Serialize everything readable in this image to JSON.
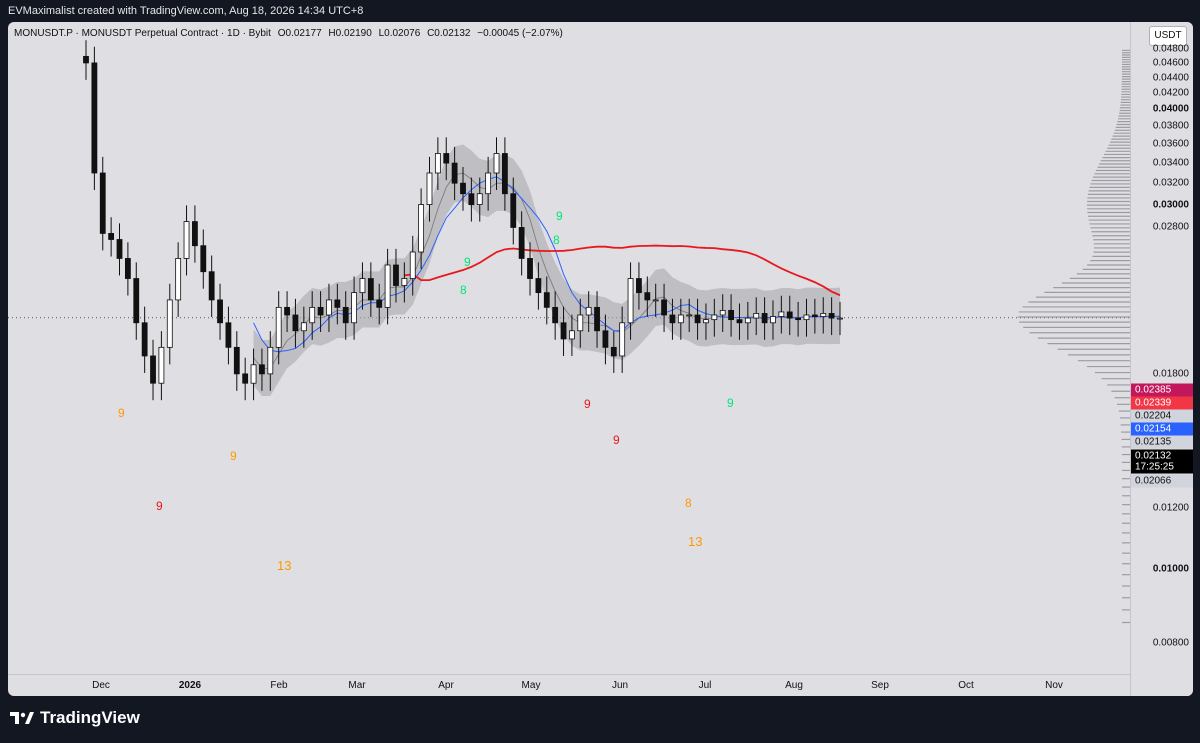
{
  "header": {
    "author_line": "EVMaximalist created with TradingView.com, Aug 18, 2026 14:34 UTC+8"
  },
  "legend": {
    "symbol": "MONUSDT.P · MONUSDT Perpetual Contract · 1D · Bybit",
    "open": "O0.02177",
    "high": "H0.02190",
    "low": "L0.02076",
    "close": "C0.02132",
    "change": "−0.00045 (−2.07%)"
  },
  "price_axis": {
    "currency": "USDT",
    "ticks": [
      "0.04800",
      "0.04600",
      "0.04400",
      "0.04200",
      "0.04000",
      "0.03800",
      "0.03600",
      "0.03400",
      "0.03200",
      "0.03000",
      "0.02800",
      "0.01800",
      "0.01600",
      "0.01400",
      "0.01200",
      "0.01000",
      "0.00800"
    ],
    "bold_ticks": [
      "0.04000",
      "0.03000",
      "0.01000"
    ],
    "badges": [
      {
        "label": "0.02385",
        "bg": "#c2185b",
        "fg": "#ffffff"
      },
      {
        "label": "0.02339",
        "bg": "#f23645",
        "fg": "#ffffff"
      },
      {
        "label": "0.02204",
        "bg": "#d1d4dc",
        "fg": "#111111"
      },
      {
        "label": "0.02154",
        "bg": "#2962ff",
        "fg": "#ffffff"
      },
      {
        "label": "0.02135",
        "bg": "#d1d4dc",
        "fg": "#111111"
      },
      {
        "label": "0.02132",
        "bg": "#000000",
        "fg": "#ffffff"
      },
      {
        "label": "17:25:25",
        "bg": "#000000",
        "fg": "#ffffff"
      },
      {
        "label": "0.02066",
        "bg": "#d1d4dc",
        "fg": "#111111"
      }
    ]
  },
  "time_axis": {
    "labels": [
      "Dec",
      "2026",
      "Feb",
      "Mar",
      "Apr",
      "May",
      "Jun",
      "Jul",
      "Aug",
      "Sep",
      "Oct",
      "Nov"
    ],
    "bold_labels": [
      "2026"
    ]
  },
  "colors": {
    "background": "#dedee3",
    "candle": "#111111",
    "ma_slow": "#e8181e",
    "ma_fast": "#2962ff",
    "band": "#a8a8ae",
    "td_buy": "#ff9800",
    "td_sell": "#00e676",
    "td_red": "#e8181e"
  },
  "chart_data": {
    "type": "candlestick",
    "symbol": "MONUSDT.P",
    "timeframe": "1D",
    "ylim": [
      0.0075,
      0.0505
    ],
    "price_line": 0.02132,
    "series": [
      {
        "name": "",
        "x": [
          "Nov 24",
          "Nov 26",
          "Nov 28",
          "Dec 1",
          "Dec 4",
          "Dec 7",
          "Dec 10",
          "Dec 13",
          "Dec 16",
          "Dec 19",
          "Dec 22",
          "Dec 25",
          "Dec 28",
          "Dec 31",
          "Jan 3",
          "Jan 6",
          "Jan 9",
          "Jan 12",
          "Jan 15",
          "Jan 18",
          "Jan 21",
          "Jan 24",
          "Jan 27",
          "Jan 30",
          "Feb 2",
          "Feb 5",
          "Feb 8",
          "Feb 11",
          "Feb 14",
          "Feb 17",
          "Feb 20",
          "Feb 23",
          "Feb 26",
          "Mar 1",
          "Mar 4",
          "Mar 7",
          "Mar 10",
          "Mar 13",
          "Mar 16",
          "Mar 19",
          "Mar 22",
          "Mar 25",
          "Mar 28",
          "Mar 31",
          "Apr 3",
          "Apr 6",
          "Apr 9",
          "Apr 12",
          "Apr 15",
          "Apr 18",
          "Apr 21",
          "Apr 24",
          "Apr 27",
          "Apr 30",
          "May 3",
          "May 6",
          "May 9",
          "May 12",
          "May 15",
          "May 18",
          "May 21",
          "May 24",
          "May 27",
          "May 30",
          "Jun 2",
          "Jun 5",
          "Jun 8",
          "Jun 11",
          "Jun 14",
          "Jun 17",
          "Jun 20",
          "Jun 23",
          "Jun 26",
          "Jun 29",
          "Jul 2",
          "Jul 5",
          "Jul 8",
          "Jul 11",
          "Jul 14",
          "Jul 17",
          "Jul 20",
          "Jul 23",
          "Jul 26",
          "Jul 29",
          "Aug 1",
          "Aug 4",
          "Aug 7",
          "Aug 10",
          "Aug 13",
          "Aug 16",
          "Aug 18"
        ],
        "values": [
          0.046,
          0.033,
          0.0275,
          0.027,
          0.0255,
          0.024,
          0.021,
          0.019,
          0.0175,
          0.0195,
          0.0225,
          0.0255,
          0.0285,
          0.0265,
          0.0245,
          0.0225,
          0.021,
          0.0195,
          0.018,
          0.0175,
          0.0185,
          0.018,
          0.0195,
          0.022,
          0.0215,
          0.0205,
          0.021,
          0.022,
          0.0215,
          0.0225,
          0.022,
          0.021,
          0.023,
          0.024,
          0.0225,
          0.022,
          0.025,
          0.0235,
          0.024,
          0.026,
          0.03,
          0.033,
          0.035,
          0.034,
          0.032,
          0.031,
          0.03,
          0.031,
          0.033,
          0.035,
          0.031,
          0.028,
          0.0255,
          0.024,
          0.023,
          0.022,
          0.021,
          0.02,
          0.0205,
          0.0215,
          0.022,
          0.0205,
          0.0195,
          0.019,
          0.021,
          0.024,
          0.023,
          0.0225,
          0.0225,
          0.0215,
          0.021,
          0.0215,
          0.0215,
          0.021,
          0.0212,
          0.0215,
          0.0218,
          0.0212,
          0.021,
          0.0213,
          0.0216,
          0.021,
          0.0214,
          0.0217,
          0.0213,
          0.0212,
          0.0215,
          0.0214,
          0.0216,
          0.0213,
          0.0213
        ]
      }
    ]
  },
  "td_labels": [
    {
      "text": "9",
      "color": "td_buy"
    },
    {
      "text": "9",
      "color": "td_red"
    },
    {
      "text": "9",
      "color": "td_buy"
    },
    {
      "text": "13",
      "color": "td_buy"
    },
    {
      "text": "9",
      "color": "td_sell"
    },
    {
      "text": "8",
      "color": "td_sell"
    },
    {
      "text": "9",
      "color": "td_sell"
    },
    {
      "text": "8",
      "color": "td_sell"
    },
    {
      "text": "9",
      "color": "td_red"
    },
    {
      "text": "9",
      "color": "td_red"
    },
    {
      "text": "8",
      "color": "td_buy"
    },
    {
      "text": "13",
      "color": "td_buy"
    },
    {
      "text": "9",
      "color": "td_sell"
    }
  ],
  "brand": {
    "name": "TradingView"
  }
}
